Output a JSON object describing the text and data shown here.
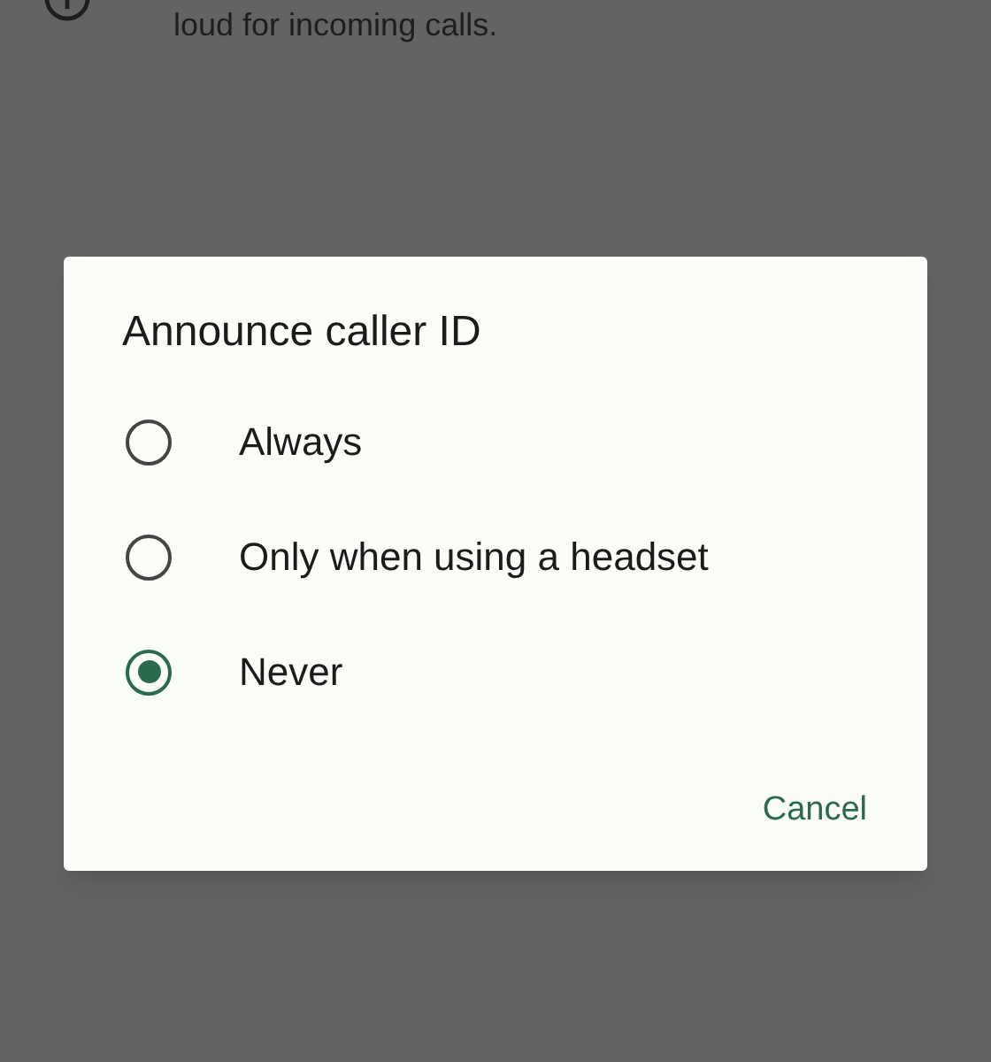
{
  "background": {
    "text": "loud for incoming calls."
  },
  "dialog": {
    "title": "Announce caller ID",
    "options": [
      {
        "label": "Always",
        "selected": false
      },
      {
        "label": "Only when using a headset",
        "selected": false
      },
      {
        "label": "Never",
        "selected": true
      }
    ],
    "buttons": [
      "Cancel"
    ]
  }
}
